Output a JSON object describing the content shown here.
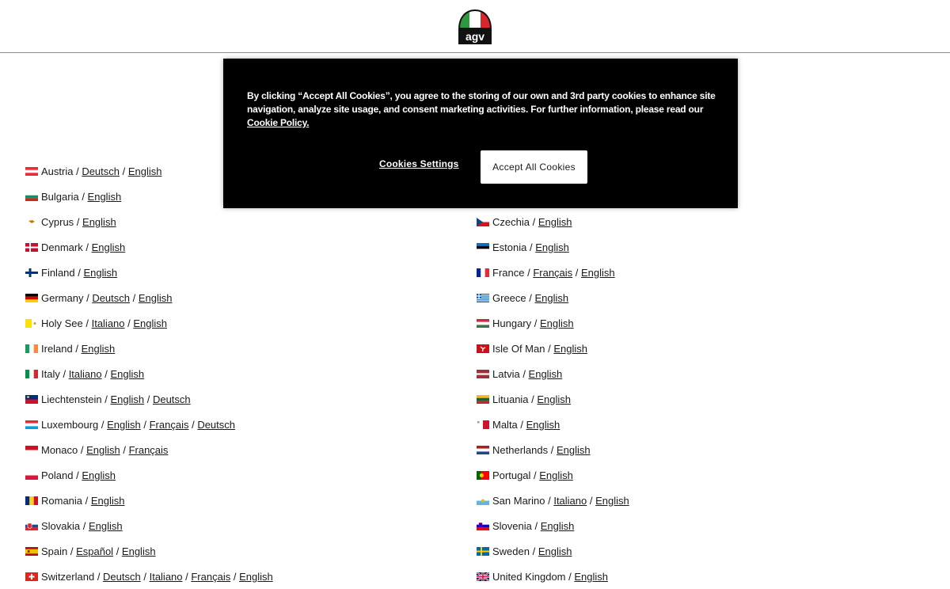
{
  "header": {
    "logo_text": "agv"
  },
  "cookie_banner": {
    "text": "By clicking “Accept All Cookies”, you agree to the storing of our own and 3rd party cookies to enhance site navigation, analyze site usage, and consent marketing activities. For further information, please read our",
    "policy_link": "Cookie Policy.",
    "settings_label": "Cookies Settings",
    "accept_label": "Accept All Cookies"
  },
  "left_column": [
    {
      "country": "Austria",
      "flag": "at",
      "langs": [
        "Deutsch",
        "English"
      ]
    },
    {
      "country": "Bulgaria",
      "flag": "bg",
      "langs": [
        "English"
      ]
    },
    {
      "country": "Cyprus",
      "flag": "cy",
      "langs": [
        "English"
      ]
    },
    {
      "country": "Denmark",
      "flag": "dk",
      "langs": [
        "English"
      ]
    },
    {
      "country": "Finland",
      "flag": "fi",
      "langs": [
        "English"
      ]
    },
    {
      "country": "Germany",
      "flag": "de",
      "langs": [
        "Deutsch",
        "English"
      ]
    },
    {
      "country": "Holy See",
      "flag": "va",
      "langs": [
        "Italiano",
        "English"
      ]
    },
    {
      "country": "Ireland",
      "flag": "ie",
      "langs": [
        "English"
      ]
    },
    {
      "country": "Italy",
      "flag": "it",
      "langs": [
        "Italiano",
        "English"
      ]
    },
    {
      "country": "Liechtenstein",
      "flag": "li",
      "langs": [
        "English",
        "Deutsch"
      ]
    },
    {
      "country": "Luxembourg",
      "flag": "lu",
      "langs": [
        "English",
        "Français",
        "Deutsch"
      ]
    },
    {
      "country": "Monaco",
      "flag": "mc",
      "langs": [
        "English",
        "Français"
      ]
    },
    {
      "country": "Poland",
      "flag": "pl",
      "langs": [
        "English"
      ]
    },
    {
      "country": "Romania",
      "flag": "ro",
      "langs": [
        "English"
      ]
    },
    {
      "country": "Slovakia",
      "flag": "sk",
      "langs": [
        "English"
      ]
    },
    {
      "country": "Spain",
      "flag": "es",
      "langs": [
        "Español",
        "English"
      ]
    },
    {
      "country": "Switzerland",
      "flag": "ch",
      "langs": [
        "Deutsch",
        "Italiano",
        "Français",
        "English"
      ]
    }
  ],
  "right_column": [
    {
      "country": "Czechia",
      "flag": "cz",
      "langs": [
        "English"
      ]
    },
    {
      "country": "Estonia",
      "flag": "ee",
      "langs": [
        "English"
      ]
    },
    {
      "country": "France",
      "flag": "fr",
      "langs": [
        "Français",
        "English"
      ]
    },
    {
      "country": "Greece",
      "flag": "gr",
      "langs": [
        "English"
      ]
    },
    {
      "country": "Hungary",
      "flag": "hu",
      "langs": [
        "English"
      ]
    },
    {
      "country": "Isle Of Man",
      "flag": "im",
      "langs": [
        "English"
      ]
    },
    {
      "country": "Latvia",
      "flag": "lv",
      "langs": [
        "English"
      ]
    },
    {
      "country": "Lituania",
      "flag": "lt",
      "langs": [
        "English"
      ]
    },
    {
      "country": "Malta",
      "flag": "mt",
      "langs": [
        "English"
      ]
    },
    {
      "country": "Netherlands",
      "flag": "nl",
      "langs": [
        "English"
      ]
    },
    {
      "country": "Portugal",
      "flag": "pt",
      "langs": [
        "English"
      ]
    },
    {
      "country": "San Marino",
      "flag": "sm",
      "langs": [
        "Italiano",
        "English"
      ]
    },
    {
      "country": "Slovenia",
      "flag": "si",
      "langs": [
        "English"
      ]
    },
    {
      "country": "Sweden",
      "flag": "se",
      "langs": [
        "English"
      ]
    },
    {
      "country": "United Kingdom",
      "flag": "gb",
      "langs": [
        "English"
      ]
    }
  ]
}
